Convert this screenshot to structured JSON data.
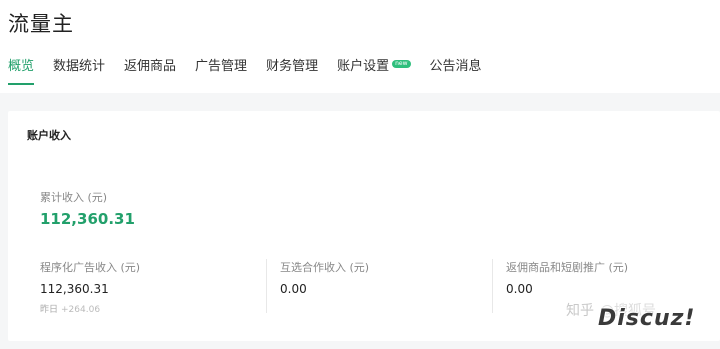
{
  "app": {
    "title": "流量主"
  },
  "tabs": [
    {
      "label": "概览",
      "active": true
    },
    {
      "label": "数据统计"
    },
    {
      "label": "返佣商品"
    },
    {
      "label": "广告管理"
    },
    {
      "label": "财务管理"
    },
    {
      "label": "账户设置",
      "badge": "new"
    },
    {
      "label": "公告消息"
    }
  ],
  "income_card": {
    "title": "账户收入",
    "total": {
      "label": "累计收入 (元)",
      "value": "112,360.31"
    },
    "metrics": [
      {
        "label": "程序化广告收入 (元)",
        "value": "112,360.31",
        "sub_label": "昨日",
        "sub_value": "+264.06"
      },
      {
        "label": "互选合作收入 (元)",
        "value": "0.00"
      },
      {
        "label": "返佣商品和短剧推广 (元)",
        "value": "0.00"
      }
    ]
  },
  "watermark": {
    "text_left": "知乎",
    "text_right": "@搜狐号",
    "logo": "Discuz!"
  },
  "colors": {
    "accent": "#22a06b",
    "background": "#f5f6f7",
    "card": "#ffffff"
  }
}
